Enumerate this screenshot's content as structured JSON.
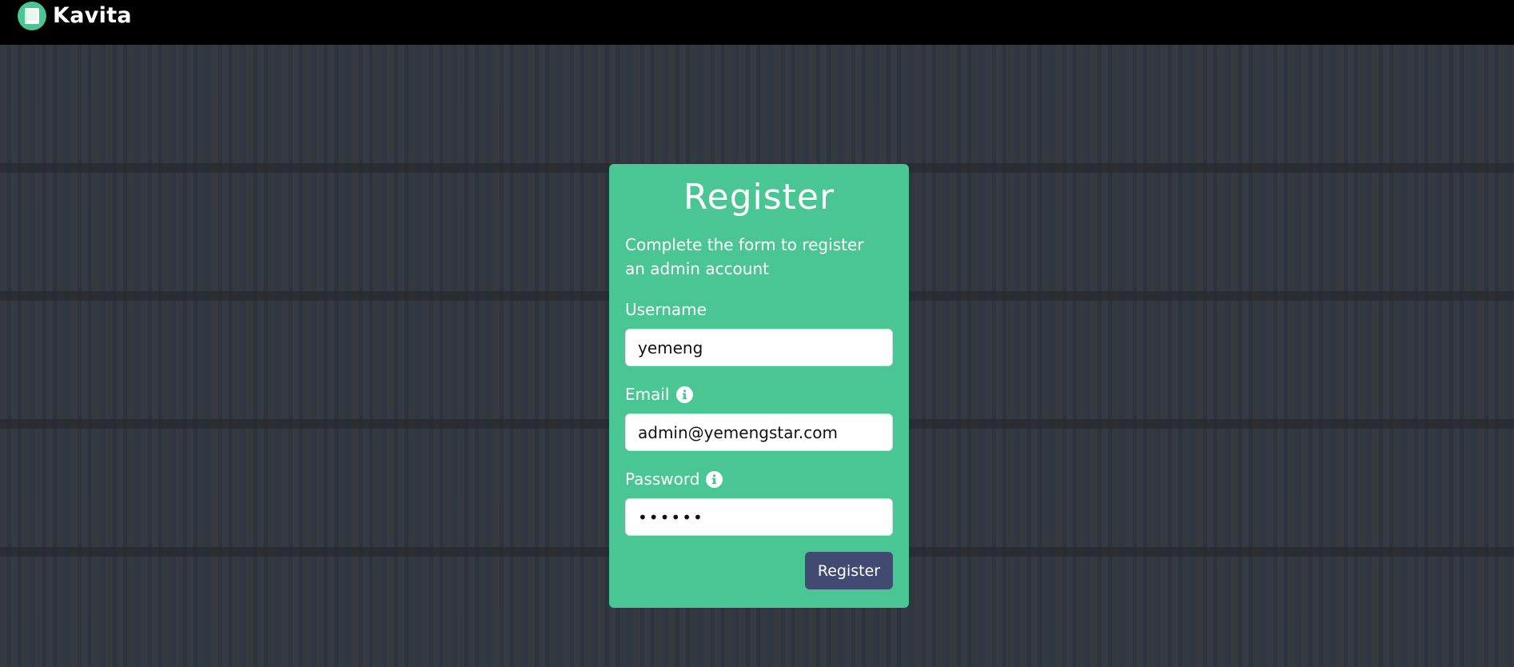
{
  "app": {
    "name": "Kavita",
    "logo_icon": "kavita-book-icon",
    "brand_color": "#4ac694"
  },
  "register_form": {
    "title": "Register",
    "description": "Complete the form to register an admin account",
    "username": {
      "label": "Username",
      "value": "yemeng"
    },
    "email": {
      "label": "Email",
      "info_icon": "info-icon",
      "value": "admin@yemengstar.com"
    },
    "password": {
      "label": "Password",
      "info_icon": "info-icon",
      "value": "••••••"
    },
    "submit_label": "Register",
    "button_color": "#414b72"
  }
}
